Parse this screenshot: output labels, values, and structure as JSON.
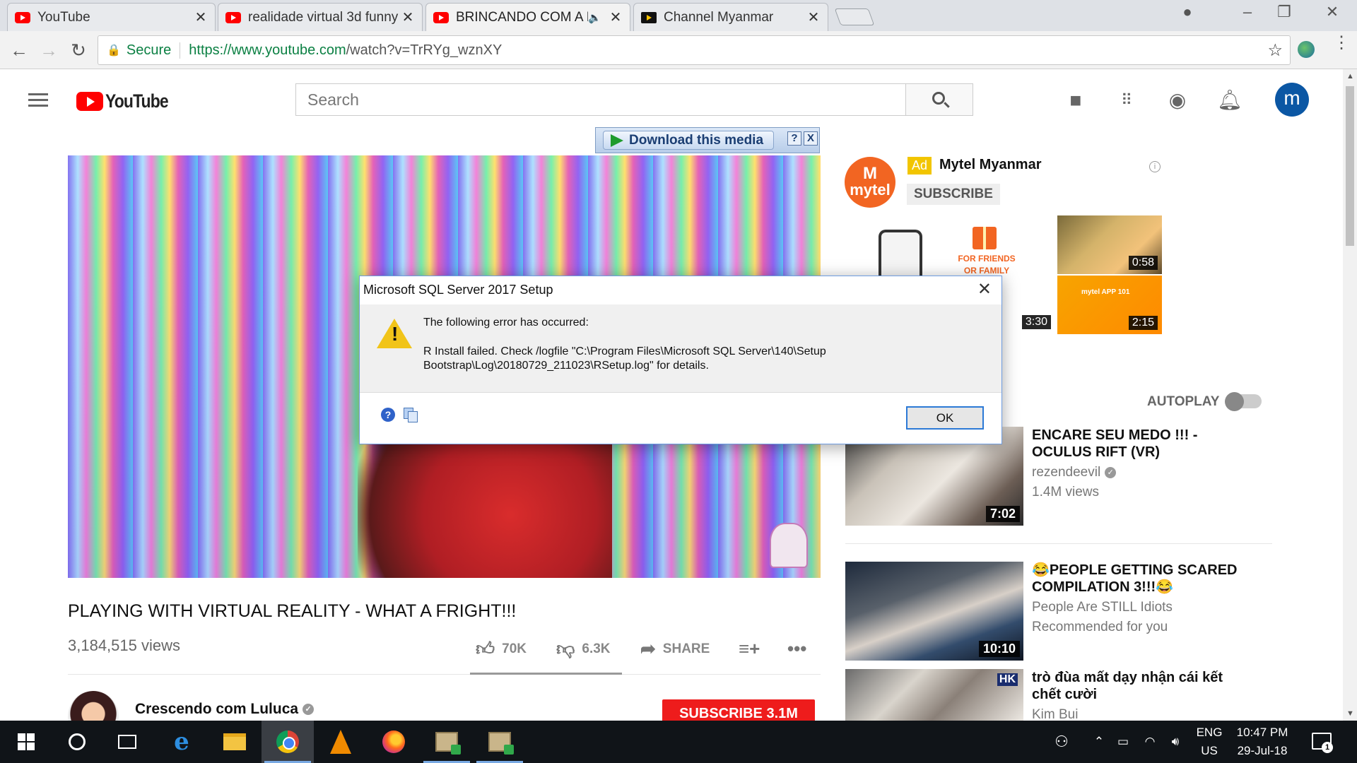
{
  "browser": {
    "tabs": [
      {
        "title": "YouTube",
        "icon": "youtube-icon"
      },
      {
        "title": "realidade virtual 3d funny",
        "icon": "youtube-icon"
      },
      {
        "title": "BRINCANDO COM A R",
        "icon": "youtube-icon",
        "audio": "speaker-icon"
      },
      {
        "title": "Channel Myanmar",
        "icon": "channel-myanmar-icon"
      }
    ],
    "security_label": "Secure",
    "url_host": "https://www.youtube.com",
    "url_path": "/watch?v=TrRYg_wznXY"
  },
  "youtube": {
    "logo_text": "YouTube",
    "search_placeholder": "Search",
    "avatar_letter": "m"
  },
  "download_bar": {
    "label": "Download this media",
    "help": "?",
    "close": "X"
  },
  "video": {
    "title": "PLAYING WITH VIRTUAL REALITY - WHAT A FRIGHT!!!",
    "views": "3,184,515 views",
    "likes": "70K",
    "dislikes": "6.3K",
    "share": "SHARE",
    "channel": "Crescendo com Luluca",
    "subscribe": "SUBSCRIBE 3.1M"
  },
  "ad": {
    "badge": "Ad",
    "name": "Mytel Myanmar",
    "logo_text": "mytel",
    "subscribe": "SUBSCRIBE",
    "friends_text": "FOR FRIENDS OR FAMILY",
    "app_text": "mytel APP 101",
    "durations": [
      "3:30",
      "0:58",
      "2:15"
    ]
  },
  "sidebar": {
    "autoplay_label": "AUTOPLAY",
    "recommendations": [
      {
        "title": "ENCARE SEU MEDO !!! - OCULUS RIFT (VR)",
        "channel": "rezendeevil",
        "meta": "1.4M views",
        "duration": "7:02",
        "verified": true
      },
      {
        "title": "😂PEOPLE GETTING SCARED COMPILATION 3!!!😂",
        "channel": "People Are STILL Idiots",
        "meta": "Recommended for you",
        "duration": "10:10",
        "verified": false
      },
      {
        "title": "trò đùa mất dạy nhận cái kết chết cười",
        "channel": "Kim Bui",
        "meta": "",
        "duration": "",
        "badge": "HK",
        "verified": false
      }
    ]
  },
  "dialog": {
    "title": "Microsoft SQL Server 2017 Setup",
    "heading": "The following error has occurred:",
    "message": "R Install failed. Check /logfile \"C:\\Program Files\\Microsoft SQL Server\\140\\Setup Bootstrap\\Log\\20180729_211023\\RSetup.log\" for details.",
    "ok": "OK"
  },
  "taskbar": {
    "language": "ENG",
    "region": "US",
    "time": "10:47 PM",
    "date": "29-Jul-18",
    "notifications": "1"
  }
}
